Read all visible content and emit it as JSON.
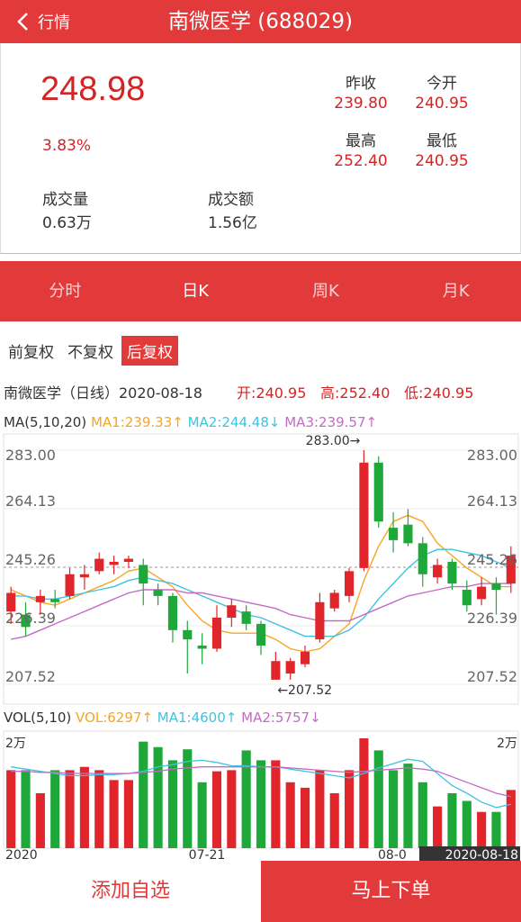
{
  "header": {
    "back_label": "行情",
    "title": "南微医学 (688029)"
  },
  "quote": {
    "price": "248.98",
    "change_pct": "3.83%",
    "prev_close_label": "昨收",
    "prev_close": "239.80",
    "open_label": "今开",
    "open": "240.95",
    "high_label": "最高",
    "high": "252.40",
    "low_label": "最低",
    "low": "240.95",
    "volume_label": "成交量",
    "volume": "0.63万",
    "amount_label": "成交额",
    "amount": "1.56亿"
  },
  "tabs": [
    "分时",
    "日K",
    "周K",
    "月K"
  ],
  "adjust": [
    "前复权",
    "不复权",
    "后复权"
  ],
  "info": {
    "name_line": "南微医学（日线）2020-08-18",
    "open": "开:240.95",
    "high": "高:252.40",
    "low": "低:240.95"
  },
  "ma_legend": {
    "label": "MA(5,10,20)",
    "ma1": "MA1:239.33↑",
    "ma2": "MA2:244.48↓",
    "ma3": "MA3:239.57↑"
  },
  "vol_legend": {
    "label": "VOL(5,10)",
    "vol": "VOL:6297↑",
    "ma1": "MA1:4600↑",
    "ma2": "MA2:5757↓"
  },
  "colors": {
    "up": "#e0262b",
    "down": "#1fa83a",
    "ma1": "#f5a623",
    "ma2": "#3ec3e0",
    "ma3": "#c46bc4",
    "accent": "#e23a3a"
  },
  "chart_data": {
    "type": "candlestick",
    "y_ticks": [
      "283.00",
      "264.13",
      "245.26",
      "226.39",
      "207.52"
    ],
    "ylim": [
      207.52,
      283.0
    ],
    "max_label": "283.00→",
    "min_label": "←207.52",
    "vol_top_left": "2万",
    "vol_top_right": "2万",
    "x_labels": [
      "2020",
      "07-21",
      "08-0",
      "2020-08-18"
    ],
    "candles": [
      [
        231,
        237,
        227,
        239
      ],
      [
        230,
        226,
        223,
        234
      ],
      [
        234,
        236,
        230,
        238
      ],
      [
        235,
        234,
        232,
        238
      ],
      [
        236,
        243,
        235,
        245
      ],
      [
        242,
        243,
        238,
        246
      ],
      [
        244,
        248,
        243,
        250
      ],
      [
        246,
        247,
        243,
        249
      ],
      [
        247,
        248,
        245,
        249
      ],
      [
        246,
        240,
        233,
        248
      ],
      [
        238,
        236,
        233,
        240
      ],
      [
        236,
        225,
        221,
        237
      ],
      [
        225,
        222,
        211,
        228
      ],
      [
        220,
        219,
        214,
        224
      ],
      [
        219,
        229,
        218,
        233
      ],
      [
        229,
        233,
        226,
        235
      ],
      [
        231,
        227,
        225,
        233
      ],
      [
        227,
        220,
        217,
        228
      ],
      [
        209,
        215,
        209,
        218
      ],
      [
        211,
        215,
        209,
        216
      ],
      [
        214,
        218,
        213,
        220
      ],
      [
        222,
        234,
        221,
        237
      ],
      [
        232,
        237,
        231,
        238
      ],
      [
        236,
        244,
        234,
        245
      ],
      [
        245,
        279,
        244,
        283
      ],
      [
        279,
        260,
        258,
        281
      ],
      [
        258,
        254,
        250,
        263
      ],
      [
        259,
        253,
        252,
        264
      ],
      [
        253,
        243,
        239,
        255
      ],
      [
        242,
        246,
        240,
        248
      ],
      [
        247,
        240,
        238,
        248
      ],
      [
        238,
        233,
        231,
        241
      ],
      [
        235,
        239,
        233,
        242
      ],
      [
        240,
        238,
        230,
        242
      ],
      [
        240,
        249,
        237,
        252
      ]
    ],
    "ma1": [
      238,
      236,
      234,
      233,
      235,
      237,
      239,
      241,
      244,
      245,
      242,
      239,
      233,
      228,
      225,
      224,
      224,
      224,
      222,
      219,
      218,
      219,
      223,
      227,
      241,
      252,
      260,
      262,
      260,
      253,
      249,
      245,
      242,
      239,
      239
    ],
    "ma2": [
      236,
      236,
      235,
      235,
      236,
      237,
      238,
      239,
      241,
      242,
      241,
      240,
      238,
      236,
      234,
      232,
      230,
      229,
      227,
      225,
      223,
      223,
      223,
      225,
      229,
      235,
      240,
      245,
      249,
      251,
      251,
      250,
      249,
      247,
      245
    ],
    "ma3": [
      222,
      223,
      225,
      227,
      229,
      231,
      233,
      235,
      237,
      238,
      238,
      238,
      237,
      237,
      236,
      235,
      234,
      233,
      232,
      230,
      229,
      228,
      228,
      228,
      230,
      232,
      234,
      236,
      237,
      238,
      239,
      239,
      240,
      240,
      240
    ],
    "volume": [
      0.71,
      0.71,
      0.5,
      0.71,
      0.71,
      0.74,
      0.71,
      0.62,
      0.62,
      0.97,
      0.92,
      0.8,
      0.9,
      0.6,
      0.7,
      0.71,
      0.89,
      0.8,
      0.8,
      0.6,
      0.55,
      0.71,
      0.5,
      0.71,
      1.0,
      0.89,
      0.71,
      0.77,
      0.6,
      0.38,
      0.5,
      0.43,
      0.33,
      0.33,
      0.53
    ],
    "vol_ma1": [
      0.74,
      0.72,
      0.7,
      0.68,
      0.66,
      0.66,
      0.67,
      0.67,
      0.68,
      0.7,
      0.74,
      0.76,
      0.79,
      0.8,
      0.78,
      0.75,
      0.75,
      0.74,
      0.74,
      0.72,
      0.7,
      0.68,
      0.66,
      0.64,
      0.68,
      0.73,
      0.77,
      0.81,
      0.79,
      0.68,
      0.57,
      0.5,
      0.42,
      0.37,
      0.4
    ],
    "vol_ma2": [
      0.7,
      0.7,
      0.69,
      0.69,
      0.68,
      0.68,
      0.68,
      0.68,
      0.68,
      0.69,
      0.7,
      0.72,
      0.73,
      0.74,
      0.74,
      0.74,
      0.74,
      0.74,
      0.74,
      0.73,
      0.72,
      0.71,
      0.7,
      0.69,
      0.7,
      0.71,
      0.72,
      0.73,
      0.72,
      0.7,
      0.65,
      0.6,
      0.55,
      0.5,
      0.47
    ]
  },
  "bottom": {
    "add_label": "添加自选",
    "order_label": "马上下单"
  }
}
